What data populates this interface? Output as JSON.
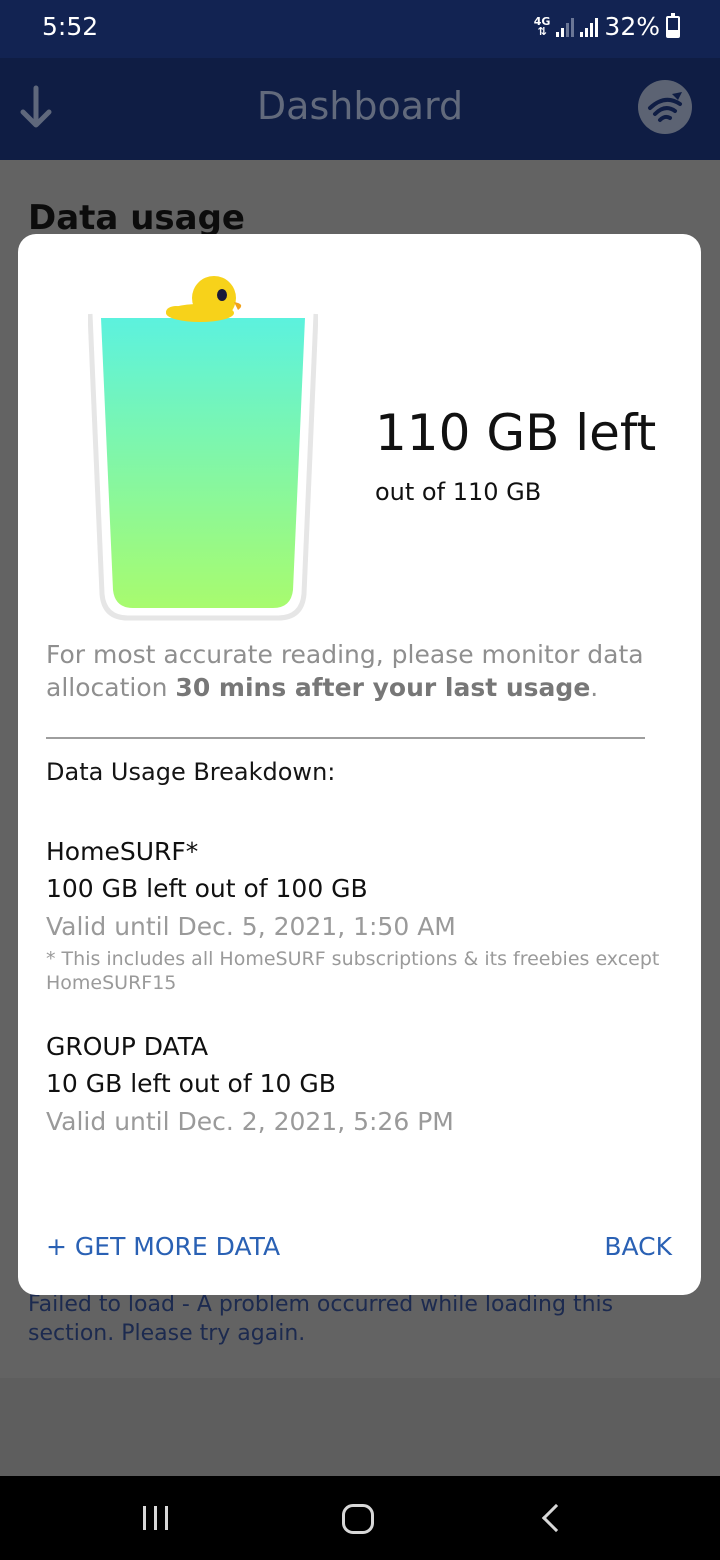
{
  "status_bar": {
    "time": "5:52",
    "network": "4G",
    "battery": "32%"
  },
  "app_bar": {
    "title": "Dashboard",
    "left_icon": "download-arrow-icon",
    "right_icon": "wifi-bird-logo-icon"
  },
  "background": {
    "section_title": "Data usage",
    "error_prefix": "Failed to load",
    "error_message": " - A problem occurred while loading this section. Please try again."
  },
  "dialog": {
    "remaining": "110 GB left",
    "total": "out of 110 GB",
    "fill_fraction": 1.0,
    "note_prefix": "For most accurate reading, please monitor data allocation ",
    "note_bold": "30 mins after your last usage",
    "note_suffix": ".",
    "breakdown_title": "Data Usage Breakdown:",
    "plans": [
      {
        "name": "HomeSURF*",
        "left": "100 GB left out of 100 GB",
        "valid": "Valid until Dec. 5, 2021, 1:50 AM",
        "footnote": "* This includes all HomeSURF subscriptions & its freebies except HomeSURF15"
      },
      {
        "name": "GROUP DATA",
        "left": "10 GB left out of 10 GB",
        "valid": "Valid until Dec. 2, 2021, 5:26 PM"
      }
    ],
    "get_more_label": "+ GET MORE DATA",
    "back_label": "BACK"
  },
  "colors": {
    "status_bar": "#122352",
    "accent": "#2a61b4",
    "glass_top": "#5cf2de",
    "glass_bottom": "#a8fb6e",
    "duck": "#f7d21a"
  }
}
